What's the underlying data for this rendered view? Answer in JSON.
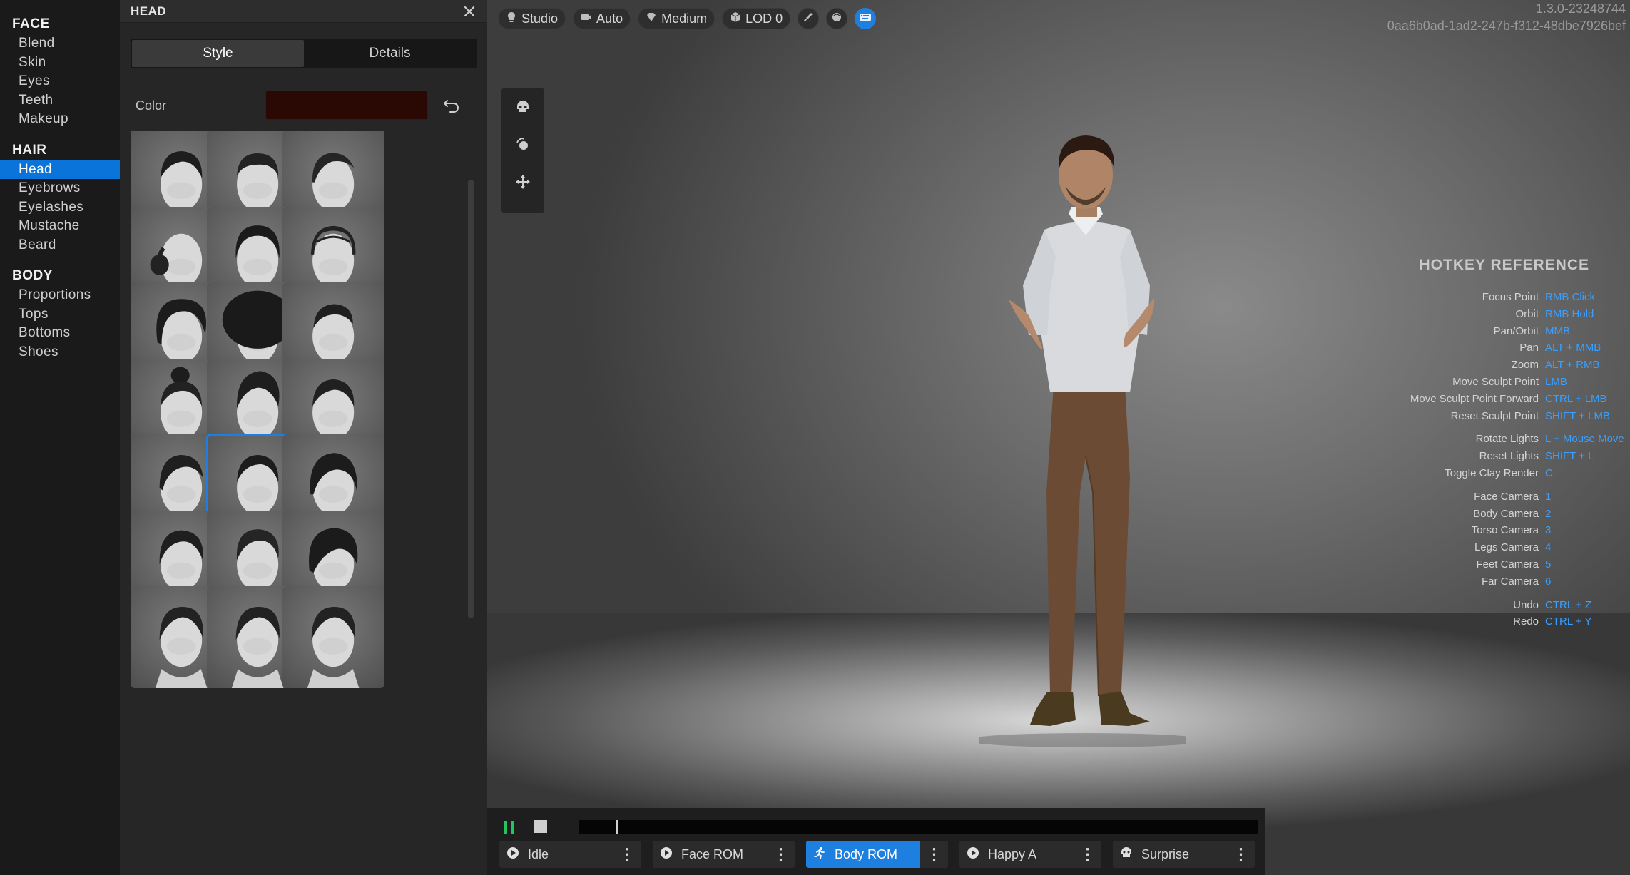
{
  "nav": {
    "groups": [
      {
        "title": "FACE",
        "items": [
          "Blend",
          "Skin",
          "Eyes",
          "Teeth",
          "Makeup"
        ]
      },
      {
        "title": "HAIR",
        "items": [
          "Head",
          "Eyebrows",
          "Eyelashes",
          "Mustache",
          "Beard"
        ]
      },
      {
        "title": "BODY",
        "items": [
          "Proportions",
          "Tops",
          "Bottoms",
          "Shoes"
        ]
      }
    ],
    "active_item": "Head"
  },
  "panel": {
    "title": "HEAD",
    "tabs": [
      "Style",
      "Details"
    ],
    "active_tab": "Style",
    "color_label": "Color",
    "color_value": "#2a0905",
    "thumbs": [
      {
        "style": "partial-top",
        "warning": false
      },
      {
        "style": "partial-top",
        "warning": false
      },
      {
        "style": "partial-top",
        "warning": false
      },
      {
        "style": "slick-short",
        "warning": false
      },
      {
        "style": "short-crop",
        "warning": false
      },
      {
        "style": "receding-short",
        "warning": false
      },
      {
        "style": "bald-bun",
        "warning": false
      },
      {
        "style": "curly-short",
        "warning": false
      },
      {
        "style": "braided",
        "warning": false
      },
      {
        "style": "curly-medium",
        "warning": false
      },
      {
        "style": "afro",
        "warning": false
      },
      {
        "style": "fade-short",
        "warning": false
      },
      {
        "style": "top-bun",
        "warning": true
      },
      {
        "style": "quiff",
        "warning": false
      },
      {
        "style": "crew-cut",
        "warning": false
      },
      {
        "style": "side-part",
        "warning": true
      },
      {
        "style": "textured-short",
        "warning": false,
        "selected": true
      },
      {
        "style": "fringe-medium",
        "warning": true
      },
      {
        "style": "wavy-short",
        "warning": true
      },
      {
        "style": "messy-short",
        "warning": false
      },
      {
        "style": "bowl-cut",
        "warning": false
      },
      {
        "style": "partial-bottom",
        "warning": false
      },
      {
        "style": "partial-bottom",
        "warning": false
      },
      {
        "style": "partial-bottom",
        "warning": false
      }
    ]
  },
  "toolbar": {
    "items": [
      {
        "label": "Studio",
        "icon": "light-bulb-icon"
      },
      {
        "label": "Auto",
        "icon": "camera-icon"
      },
      {
        "label": "Medium",
        "icon": "quality-diamond-icon"
      },
      {
        "label": "LOD 0",
        "icon": "cube-icon"
      }
    ],
    "round_icons": [
      "brush-icon",
      "sphere-icon",
      "keyboard-icon"
    ]
  },
  "version": "1.3.0-23248744",
  "guid": "0aa6b0ad-1ad2-247b-f312-48dbe7926bef",
  "side_tools": [
    "skull-icon",
    "rotate-light-icon",
    "move-icon"
  ],
  "hotkeys": {
    "title": "HOTKEY REFERENCE",
    "groups": [
      [
        {
          "label": "Focus Point",
          "key": "RMB Click"
        },
        {
          "label": "Orbit",
          "key": "RMB Hold"
        },
        {
          "label": "Pan/Orbit",
          "key": "MMB"
        },
        {
          "label": "Pan",
          "key": "ALT + MMB"
        },
        {
          "label": "Zoom",
          "key": "ALT + RMB"
        },
        {
          "label": "Move Sculpt Point",
          "key": "LMB"
        },
        {
          "label": "Move Sculpt Point Forward",
          "key": "CTRL + LMB"
        },
        {
          "label": "Reset Sculpt Point",
          "key": "SHIFT + LMB"
        }
      ],
      [
        {
          "label": "Rotate Lights",
          "key": "L + Mouse Move"
        },
        {
          "label": "Reset Lights",
          "key": "SHIFT + L"
        },
        {
          "label": "Toggle Clay Render",
          "key": "C"
        }
      ],
      [
        {
          "label": "Face Camera",
          "key": "1"
        },
        {
          "label": "Body Camera",
          "key": "2"
        },
        {
          "label": "Torso Camera",
          "key": "3"
        },
        {
          "label": "Legs Camera",
          "key": "4"
        },
        {
          "label": "Feet Camera",
          "key": "5"
        },
        {
          "label": "Far Camera",
          "key": "6"
        }
      ],
      [
        {
          "label": "Undo",
          "key": "CTRL + Z"
        },
        {
          "label": "Redo",
          "key": "CTRL + Y"
        }
      ]
    ]
  },
  "timeline": {
    "playhead_fraction": 0.055,
    "animations": [
      {
        "label": "Idle",
        "icon": "play-circle-icon",
        "active": false
      },
      {
        "label": "Face ROM",
        "icon": "play-circle-icon",
        "active": false
      },
      {
        "label": "Body ROM",
        "icon": "running-figure-icon",
        "active": true
      },
      {
        "label": "Happy A",
        "icon": "play-circle-icon",
        "active": false
      },
      {
        "label": "Surprise",
        "icon": "face-icon",
        "active": false
      }
    ]
  },
  "colors": {
    "accent": "#1d7fe0",
    "hotkey": "#3aa0ff",
    "play": "#22c55e"
  }
}
